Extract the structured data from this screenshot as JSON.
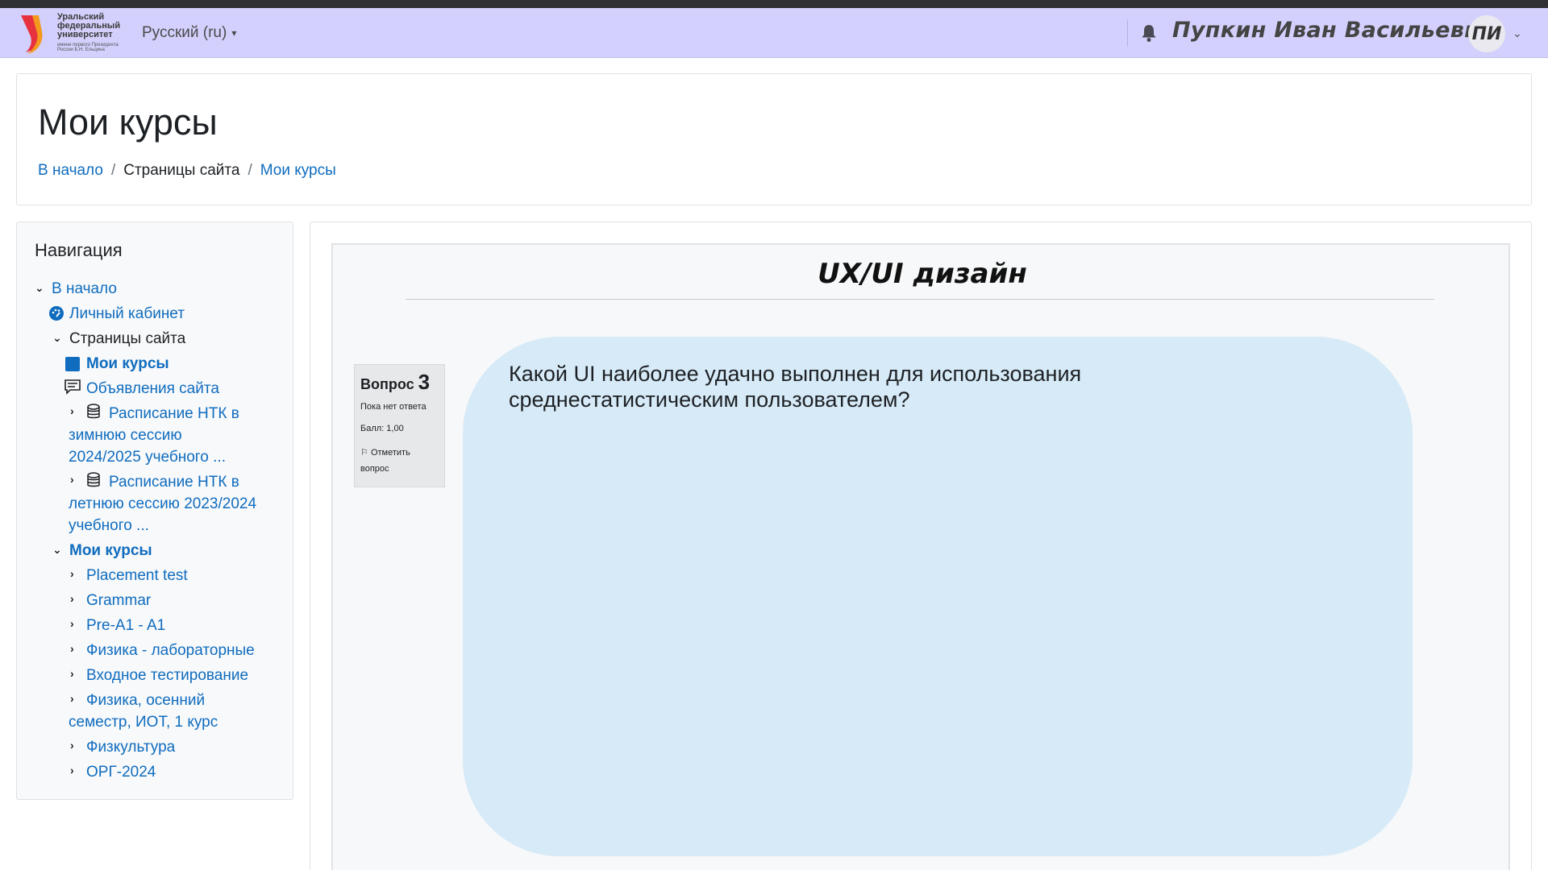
{
  "branding": {
    "logo_line1": "Уральский",
    "logo_line2": "федеральный",
    "logo_line3": "университет",
    "logo_small": "имени первого Президента России Б.Н. Ельцина"
  },
  "navbar": {
    "language": "Русский (ru)",
    "user_name": "Пупкин Иван Васильевич",
    "avatar_initials": "ПИ"
  },
  "header": {
    "title": "Мои курсы",
    "breadcrumb": [
      "В начало",
      "/",
      "Страницы сайта",
      "/",
      "Мои курсы"
    ]
  },
  "navigation": {
    "title": "Навигация",
    "items": [
      "В начало",
      "Личный кабинет",
      "Страницы сайта",
      "Мои курсы",
      "Объявления сайта",
      "Расписание НТК в",
      "зимнюю сессию",
      "2024/2025 учебного ...",
      "Расписание НТК в",
      "летнюю сессию 2023/2024",
      "учебного ...",
      "Мои курсы",
      "Placement test",
      "Grammar",
      "Pre-A1 - A1",
      "Физика - лабораторные",
      "Входное тестирование",
      "Физика, осенний",
      "семестр, ИОТ, 1 курс",
      "Физкультура",
      "ОРГ-2024"
    ]
  },
  "quiz": {
    "title": "UX/UI дизайн",
    "question_label": "Вопрос",
    "question_number": "3",
    "state": "Пока нет ответа",
    "grade": "Балл: 1,00",
    "flag": "Отметить вопрос",
    "question_text": "Какой UI наиболее удачно выполнен для использования среднестатистическим пользователем?"
  },
  "colors": {
    "navbar": "#d3d0fd",
    "link": "#0f6cbf",
    "bubble": "#d7eaf7"
  }
}
